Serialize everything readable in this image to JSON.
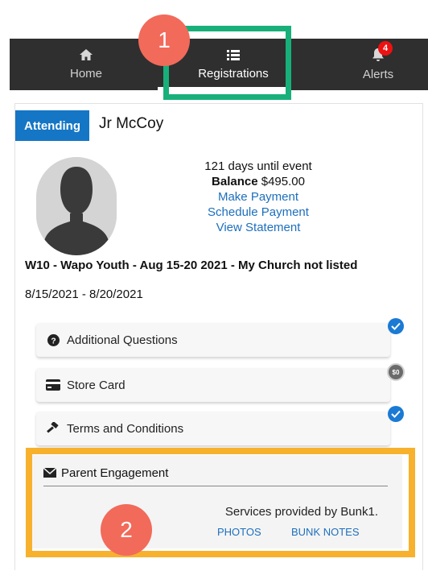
{
  "nav": {
    "home": "Home",
    "registrations": "Registrations",
    "alerts": "Alerts",
    "alerts_count": "4"
  },
  "markers": {
    "one": "1",
    "two": "2"
  },
  "registration": {
    "status_tab": "Attending",
    "camper_name": "Jr McCoy",
    "days_until_event": "121 days until event",
    "balance_label": "Balance",
    "balance_amount": "$495.00",
    "make_payment": "Make Payment",
    "schedule_payment": "Schedule Payment",
    "view_statement": "View Statement",
    "event_title": "W10 - Wapo Youth - Aug 15-20 2021 - My Church not listed",
    "event_dates": "8/15/2021 - 8/20/2021"
  },
  "sections": {
    "additional_questions": "Additional Questions",
    "store_card": "Store Card",
    "store_card_amount": "$0",
    "terms": "Terms and Conditions",
    "parent_engagement": "Parent Engagement",
    "services_text": "Services provided by Bunk1.",
    "photos": "PHOTOS",
    "bunk_notes": "BUNK NOTES"
  },
  "colors": {
    "nav_bg": "#2f2f2f",
    "accent_blue": "#1576c5",
    "highlight_green": "#18b07a",
    "highlight_orange": "#f7b12d",
    "marker_red": "#f26a5a"
  },
  "icons": {
    "home": "home-icon",
    "registrations": "list-icon",
    "alerts": "bell-icon",
    "additional_questions": "question-circle-icon",
    "store_card": "credit-card-icon",
    "terms": "gavel-icon",
    "parent_engagement": "envelope-icon"
  }
}
